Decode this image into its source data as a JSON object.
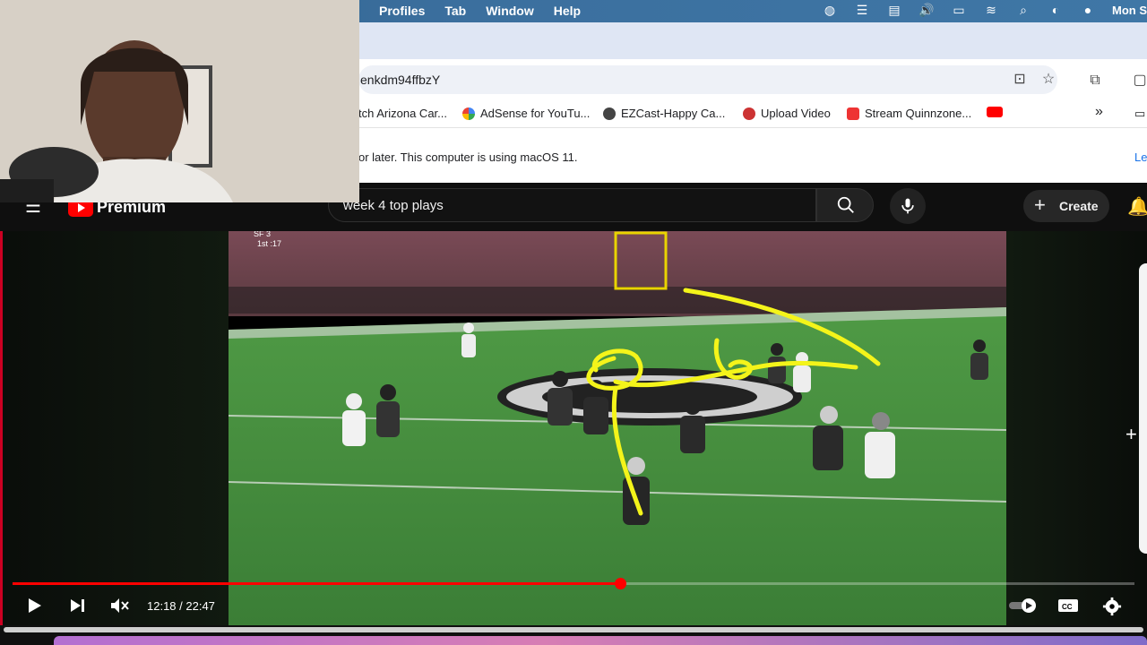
{
  "menubar": {
    "items": [
      "Profiles",
      "Tab",
      "Window",
      "Help"
    ],
    "clock": "Mon S"
  },
  "browser": {
    "url": "enkdm94ffbzY",
    "bookmarks": [
      {
        "label": "tch Arizona Car...",
        "icon": "arizona-icon"
      },
      {
        "label": "AdSense for YouTu...",
        "icon": "google-icon"
      },
      {
        "label": "EZCast-Happy Ca...",
        "icon": "globe-icon"
      },
      {
        "label": "Upload Video",
        "icon": "upload-icon"
      },
      {
        "label": "Stream Quinnzone...",
        "icon": "stream-icon"
      }
    ],
    "overflow_label": "»",
    "infobar_text": "or later. This computer is using macOS 11.",
    "infobar_link": "Le"
  },
  "youtube": {
    "brand": "Premium",
    "search_query": "week 4 top plays",
    "create_label": "Create"
  },
  "player": {
    "current_time": "12:18",
    "duration": "22:47",
    "time_display": "12:18 / 22:47",
    "progress_fraction": 0.5415,
    "scoreboard_top": "SF   3",
    "scoreboard_bottom": "1st   :17"
  },
  "colors": {
    "youtube_red": "#ff0000",
    "annotation_yellow": "#f4f41a",
    "field_green": "#3f8a3a"
  }
}
